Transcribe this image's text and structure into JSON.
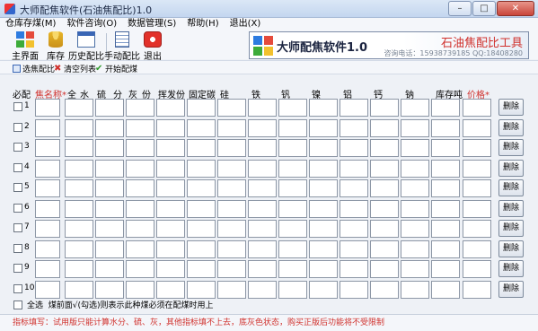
{
  "window": {
    "title": "大师配焦软件(石油焦配比)1.0",
    "controls": [
      "–",
      "□",
      "✕"
    ]
  },
  "menu": [
    "仓库存煤(M)",
    "软件咨询(O)",
    "数据管理(S)",
    "帮助(H)",
    "退出(X)"
  ],
  "toolbar": {
    "main": "主界面",
    "stock": "库存",
    "history": "历史配比",
    "manual": "手动配比",
    "exit": "退出"
  },
  "banner": {
    "name": "大师配焦软件1.0",
    "brand": "石油焦配比工具",
    "phone": "咨询电话：15938739185",
    "qq": "QQ:18408280"
  },
  "subtoolbar": {
    "select": "选焦配比",
    "clear": "清空列表",
    "start": "开始配煤"
  },
  "columns": [
    "必配",
    "焦名称",
    "全",
    "水",
    "硫",
    "分",
    "灰",
    "份",
    "挥发份",
    "固定碳",
    "硅",
    "铁",
    "钒",
    "镍",
    "铝",
    "钙",
    "钠",
    "库存吨",
    "价格"
  ],
  "required_marks": {
    "name": "*",
    "price": "*"
  },
  "rows": [
    {
      "no": "1",
      "delete": "删除"
    },
    {
      "no": "2",
      "delete": "删除"
    },
    {
      "no": "3",
      "delete": "删除"
    },
    {
      "no": "4",
      "delete": "删除"
    },
    {
      "no": "5",
      "delete": "删除"
    },
    {
      "no": "6",
      "delete": "删除"
    },
    {
      "no": "7",
      "delete": "删除"
    },
    {
      "no": "8",
      "delete": "删除"
    },
    {
      "no": "9",
      "delete": "删除"
    },
    {
      "no": "10",
      "delete": "删除"
    }
  ],
  "footer": {
    "select_all": "全选",
    "hint": "煤前面√(勾选)则表示此种煤必须在配煤时用上"
  },
  "note": "指标填写：试用版只能计算水分、硫、灰，其他指标填不上去，底灰色状态，购买正版后功能将不受限制"
}
